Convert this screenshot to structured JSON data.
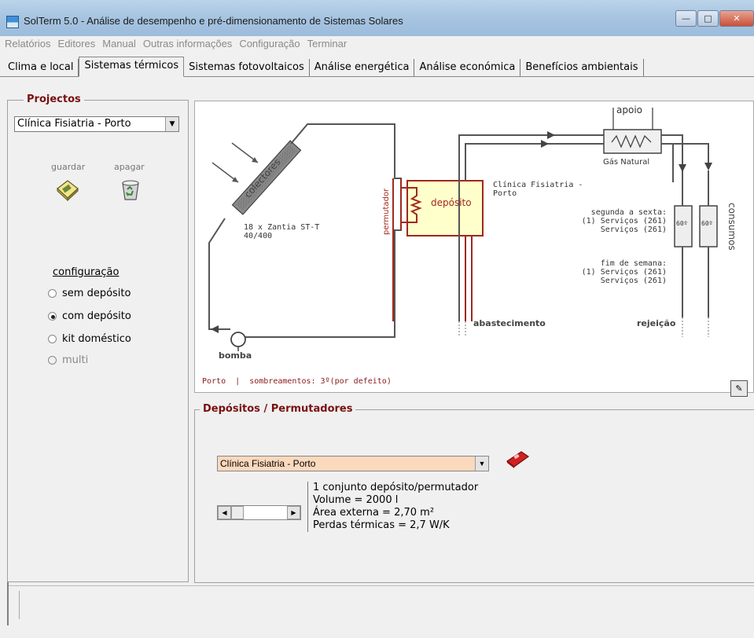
{
  "window": {
    "title": "SolTerm 5.0 - Análise de desempenho e pré-dimensionamento de Sistemas Solares",
    "controls": [
      "minimize",
      "maximize",
      "close"
    ]
  },
  "menu": [
    "Relatórios",
    "Editores",
    "Manual",
    "Outras informações",
    "Configuração",
    "Terminar"
  ],
  "tabs": [
    {
      "label": "Clima e local",
      "active": false
    },
    {
      "label": "Sistemas térmicos",
      "active": true
    },
    {
      "label": "Sistemas fotovoltaicos",
      "active": false
    },
    {
      "label": "Análise energética",
      "active": false
    },
    {
      "label": "Análise económica",
      "active": false
    },
    {
      "label": "Benefícios ambientais",
      "active": false
    }
  ],
  "projects": {
    "legend": "Projectos",
    "selected": "Clínica Fisiatria - Porto",
    "save_label": "guardar",
    "delete_label": "apagar"
  },
  "configuration": {
    "label": "configuração",
    "options": [
      {
        "label": "sem depósito",
        "checked": false,
        "enabled": true
      },
      {
        "label": "com depósito",
        "checked": true,
        "enabled": true
      },
      {
        "label": "kit doméstico",
        "checked": false,
        "enabled": true
      },
      {
        "label": "multi",
        "checked": false,
        "enabled": false
      }
    ]
  },
  "diagram": {
    "collectors_label": "colectores",
    "collectors_desc_1": "18 x Zantia ST-T",
    "collectors_desc_2": "40/400",
    "exchanger_label": "permutador",
    "tank_label": "depósito",
    "tank_name_1": "Clínica Fisiatria -",
    "tank_name_2": "Porto",
    "backup_label": "apoio",
    "backup_fuel": "Gás Natural",
    "weekday_title": "segunda a sexta:",
    "weekday_line_1": "(1) Serviços (261)",
    "weekday_line_2": "Serviços (261)",
    "weekend_title": "fim de semana:",
    "weekend_line_1": "(1) Serviços (261)",
    "weekend_line_2": "Serviços (261)",
    "consumption_label": "consumos",
    "temp_1": "60º",
    "temp_2": "60º",
    "supply_label": "abastecimento",
    "rejection_label": "rejeição",
    "pump_label": "bomba",
    "location": "Porto",
    "shading": "sombreamentos: 3º(por defeito)"
  },
  "storage": {
    "legend": "Depósitos / Permutadores",
    "selected": "Clínica Fisiatria - Porto",
    "info": [
      "1 conjunto depósito/permutador",
      "Volume = 2000 l",
      "Área externa = 2,70 m²",
      "Perdas térmicas = 2,7 W/K"
    ]
  },
  "colors": {
    "legend_red": "#7a1010",
    "tank_fill": "#ffffcc",
    "exchanger": "#a0281e",
    "pipe": "#555555",
    "dropdown_bg": "#fbd9bd"
  }
}
